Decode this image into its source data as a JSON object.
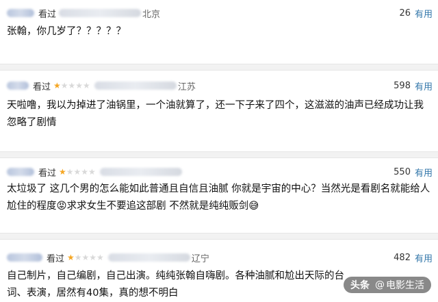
{
  "reviews": [
    {
      "watched_label": "看过",
      "stars_on": 0,
      "location": "北京",
      "votes": "26",
      "useful_label": "有用",
      "text": "张翰，你几岁了？？？？？"
    },
    {
      "watched_label": "看过",
      "stars_on": 1,
      "location": "江苏",
      "votes": "598",
      "useful_label": "有用",
      "text": "天啦噜，我以为掉进了油锅里，一个油就算了，还一下子来了四个，这滋滋的油声已经成功让我忽略了剧情"
    },
    {
      "watched_label": "看过",
      "stars_on": 1,
      "location": "",
      "votes": "550",
      "useful_label": "有用",
      "text": "太垃圾了 这几个男的怎么能如此普通且自信且油腻 你就是宇宙的中心？当然光是看剧名就能给人尬住的程度😡求求女生不要追这部剧 不然就是纯纯贩剑😅"
    },
    {
      "watched_label": "看过",
      "stars_on": 1,
      "location": "辽宁",
      "votes": "482",
      "useful_label": "有用",
      "text": "自己制片，自己编剧，自己出演。纯纯张翰自嗨剧。各种油腻和尬出天际的台词、表演，居然有40集，真的想不明白"
    }
  ],
  "watermark": {
    "platform": "头条",
    "at": "@",
    "account": "电影生活"
  },
  "colors": {
    "star_on": "#f5a623",
    "star_off": "#d9d9d9",
    "useful": "#3377aa",
    "separator": "#f2f2f2"
  }
}
